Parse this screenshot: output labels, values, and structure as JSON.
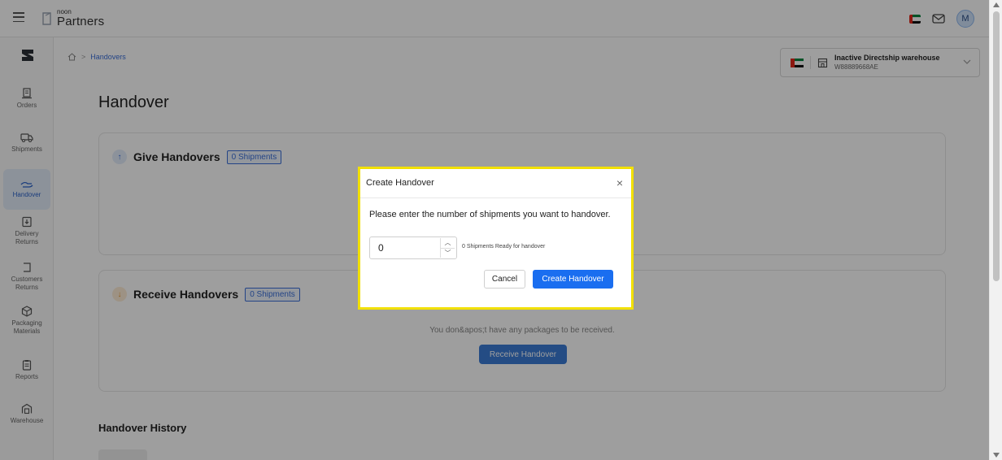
{
  "app": {
    "logo_small": "noon",
    "logo_big": "Partners",
    "avatar_initial": "M",
    "colors": {
      "accent": "#1a6ef0",
      "active_nav": "#2a62c9",
      "highlight_frame": "#f2e000"
    }
  },
  "sidebar": {
    "items": [
      {
        "label": "Orders",
        "icon": "orders-icon"
      },
      {
        "label": "Shipments",
        "icon": "truck-icon"
      },
      {
        "label": "Handover",
        "icon": "handover-icon",
        "active": true
      },
      {
        "label": "Delivery Returns",
        "icon": "return-box-icon"
      },
      {
        "label": "Customers Returns",
        "icon": "customer-return-icon"
      },
      {
        "label": "Packaging Materials",
        "icon": "package-icon"
      },
      {
        "label": "Reports",
        "icon": "report-icon"
      },
      {
        "label": "Warehouse",
        "icon": "warehouse-icon"
      }
    ]
  },
  "breadcrumb": {
    "current": "Handovers"
  },
  "warehouse": {
    "name": "Inactive Directship warehouse",
    "code": "W88889668AE"
  },
  "page": {
    "title": "Handover",
    "give": {
      "title": "Give Handovers",
      "badge": "0 Shipments"
    },
    "receive": {
      "title": "Receive Handovers",
      "badge": "0 Shipments",
      "empty_text": "You don&apos;t have any packages to be received.",
      "button": "Receive Handover"
    },
    "history_title": "Handover History"
  },
  "modal": {
    "title": "Create Handover",
    "question": "Please enter the number of shipments you want to handover.",
    "input_value": "0",
    "ready_text": "0 Shipments Ready for handover",
    "cancel": "Cancel",
    "create": "Create Handover"
  }
}
